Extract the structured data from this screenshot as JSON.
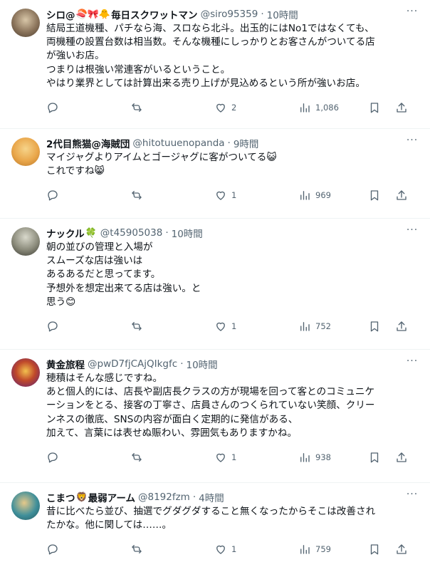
{
  "tweets": [
    {
      "name": "シロ@",
      "emoji": "🍣🎀🐥",
      "name2": "毎日スクワットマン",
      "handle": "@siro95359",
      "time": "10時間",
      "text": "結局王道機種、パチなら海、スロなら北斗。出玉的にはNo1ではなくても、\n両機種の設置台数は相当数。そんな機種にしっかりとお客さんがついてる店\nが強いお店。\nつまりは根強い常連客がいるということ。\nやはり業界としては計算出来る売り上げが見込めるという所が強いお店。",
      "replies": "",
      "retweets": "",
      "likes": "2",
      "views": "1,086",
      "avatar_color": "#6b5a4a"
    },
    {
      "name": "2代目熊猫@海賊団",
      "emoji": "",
      "name2": "",
      "handle": "@hitotuuenopanda",
      "time": "9時間",
      "text": "マイジャグよりアイムとゴージャグに客がついてる😺\nこれですね😸",
      "replies": "",
      "retweets": "",
      "likes": "1",
      "views": "969",
      "avatar_color": "#e9a64a"
    },
    {
      "name": "ナックル",
      "emoji": "🍀",
      "name2": "",
      "handle": "@t45905038",
      "time": "10時間",
      "text": "朝の並びの管理と入場が\nスムーズな店は強いは\nあるあるだと思ってます。\n予想外を想定出来てる店は強い。と\n思う😊",
      "replies": "",
      "retweets": "",
      "likes": "1",
      "views": "752",
      "avatar_color": "#8a8a7a"
    },
    {
      "name": "黄金旅程",
      "emoji": "",
      "name2": "",
      "handle": "@pwD7fjCAjQIkgfc",
      "time": "10時間",
      "text": "穂積はそんな感じですね。\nあと個人的には、店長や副店長クラスの方が現場を回って客とのコミュニケ\nーションをとる、接客の丁寧さ、店員さんのつくられていない笑顔、クリー\nンネスの徹底、SNSの内容が面白く定期的に発信がある、\n加えて、言葉には表せぬ賑わい、雰囲気もありますかね。",
      "replies": "",
      "retweets": "",
      "likes": "1",
      "views": "938",
      "avatar_color": "#7a3ea0"
    },
    {
      "name": "こまつ",
      "emoji": "🦁",
      "name2": "最弱アーム",
      "handle": "@8192fzm",
      "time": "4時間",
      "text": "昔に比べたら並び、抽選でグダグダすること無くなったからそこは改善され\nたかな。他に関しては……。",
      "replies": "",
      "retweets": "",
      "likes": "1",
      "views": "759",
      "avatar_color": "#3f8f9a"
    }
  ],
  "icons": {
    "more": "more-horizontal-icon",
    "reply": "reply-icon",
    "retweet": "retweet-icon",
    "like": "heart-icon",
    "views": "views-icon",
    "bookmark": "bookmark-icon",
    "share": "share-icon"
  }
}
